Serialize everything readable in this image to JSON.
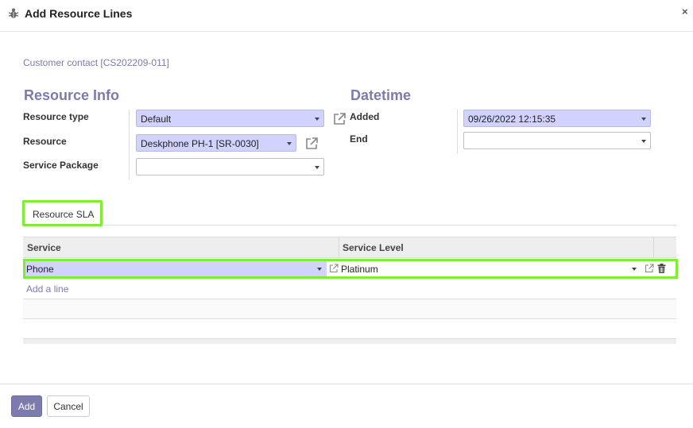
{
  "dialog": {
    "title": "Add Resource Lines",
    "close_glyph": "×"
  },
  "record": {
    "breadcrumb": "Customer contact [CS202209-011]"
  },
  "resource_info": {
    "heading": "Resource Info",
    "resource_type": {
      "label": "Resource type",
      "value": "Default"
    },
    "resource": {
      "label": "Resource",
      "value": "Deskphone PH-1 [SR-0030]"
    },
    "service_package": {
      "label": "Service Package",
      "value": ""
    }
  },
  "datetime": {
    "heading": "Datetime",
    "added": {
      "label": "Added",
      "value": "09/26/2022 12:15:35"
    },
    "end": {
      "label": "End",
      "value": ""
    }
  },
  "tabs": [
    {
      "label": "Resource SLA",
      "active": true
    }
  ],
  "sla_table": {
    "columns": [
      "Service",
      "Service Level"
    ],
    "rows": [
      {
        "service": "Phone",
        "service_level": "Platinum"
      }
    ],
    "add_line": "Add a line"
  },
  "footer": {
    "add_label": "Add",
    "cancel_label": "Cancel"
  },
  "colors": {
    "accent": "#7c7bad",
    "required_field": "#d2d2ff",
    "highlight": "#7dee30"
  },
  "icons": [
    "bug-icon",
    "close-icon",
    "external-link-icon",
    "trash-icon",
    "caret-down-icon"
  ]
}
